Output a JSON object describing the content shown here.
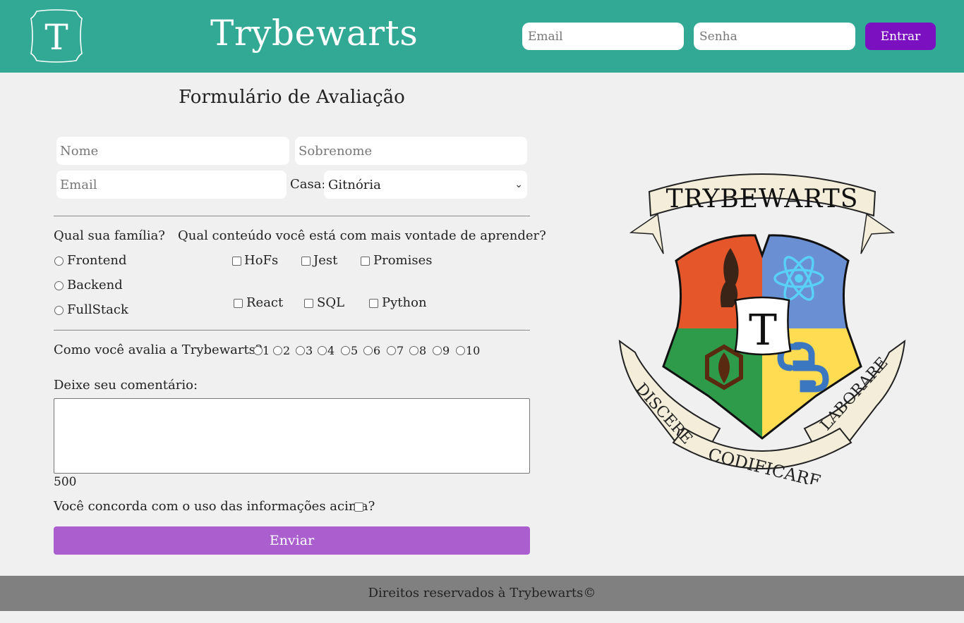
{
  "header": {
    "logo_letter": "T",
    "title": "Trybewarts",
    "email_placeholder": "Email",
    "password_placeholder": "Senha",
    "login_button": "Entrar"
  },
  "form": {
    "title": "Formulário de Avaliação",
    "name_placeholder": "Nome",
    "lastname_placeholder": "Sobrenome",
    "email_placeholder": "Email",
    "house_label": "Casa:",
    "house_selected": "Gitnória",
    "family_question": "Qual sua família?",
    "families": [
      "Frontend",
      "Backend",
      "FullStack"
    ],
    "content_question": "Qual conteúdo você está com mais vontade de aprender?",
    "subjects": [
      "HoFs",
      "Jest",
      "Promises",
      "React",
      "SQL",
      "Python"
    ],
    "rating_question": "Como você avalia a Trybewarts?",
    "ratings": [
      "1",
      "2",
      "3",
      "4",
      "5",
      "6",
      "7",
      "8",
      "9",
      "10"
    ],
    "comment_label": "Deixe seu comentário:",
    "char_counter": "500",
    "agreement_label": "Você concorda com o uso das informações acima?",
    "submit_button": "Enviar"
  },
  "crest": {
    "banner_top": "TRYBEWARTS",
    "center_letter": "T",
    "motto_left": "DISCERE",
    "motto_bottom": "CODIFICARE",
    "motto_right": "LABORARE",
    "colors": {
      "red": "#e5562a",
      "blue": "#6a8fd3",
      "green": "#2d9b4a",
      "yellow": "#ffdc52",
      "ribbon": "#f3edd9"
    }
  },
  "footer": {
    "text": "Direitos reservados à Trybewarts©"
  },
  "colors": {
    "header_bg": "#32a994",
    "login_button": "#7a10c0",
    "submit_button": "#ab5fcf",
    "footer_bg": "#808080",
    "page_bg": "#f0f0f0"
  }
}
